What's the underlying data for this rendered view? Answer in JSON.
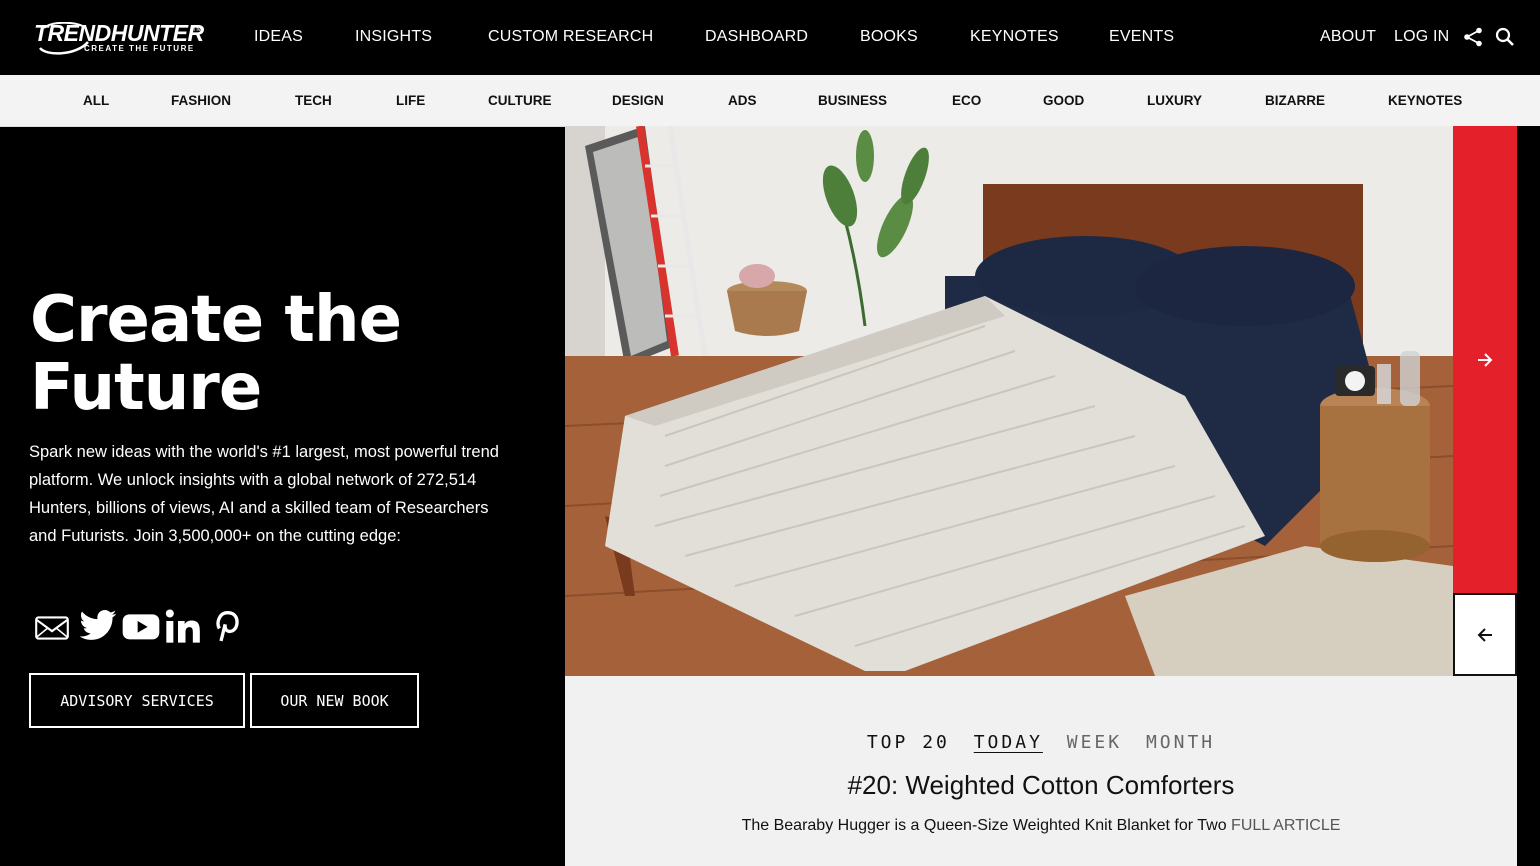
{
  "logo": {
    "name": "TRENDHUNTER",
    "tagline": "CREATE THE FUTURE",
    "tm": "TM"
  },
  "nav": {
    "items": [
      "IDEAS",
      "INSIGHTS",
      "CUSTOM RESEARCH",
      "DASHBOARD",
      "BOOKS",
      "KEYNOTES",
      "EVENTS"
    ],
    "about": "ABOUT",
    "login": "LOG IN"
  },
  "categories": [
    "ALL",
    "FASHION",
    "TECH",
    "LIFE",
    "CULTURE",
    "DESIGN",
    "ADS",
    "BUSINESS",
    "ECO",
    "GOOD",
    "LUXURY",
    "BIZARRE",
    "KEYNOTES"
  ],
  "hero": {
    "title_line1": "Create the",
    "title_line2": "Future",
    "description": "Spark new ideas with the world's #1 largest, most powerful trend platform. We unlock insights with a global network of 272,514 Hunters, billions of views, AI and a skilled team of Researchers and Futurists. Join 3,500,000+ on the cutting edge:",
    "buttons": {
      "advisory": "ADVISORY SERVICES",
      "book": "OUR NEW BOOK"
    }
  },
  "social": [
    "mail-icon",
    "twitter-icon",
    "youtube-icon",
    "linkedin-icon",
    "pinterest-icon"
  ],
  "top20": {
    "label": "TOP 20",
    "tabs": {
      "today": "TODAY",
      "week": "WEEK",
      "month": "MONTH"
    },
    "title": "#20: Weighted Cotton Comforters",
    "subtitle": "The Bearaby Hugger is a Queen-Size Weighted Knit Blanket for Two",
    "link": "FULL ARTICLE"
  },
  "colors": {
    "accent_red": "#e4202a",
    "background": "#000000",
    "catbar": "#f3f3f3",
    "info_panel": "#f1f1f1"
  }
}
